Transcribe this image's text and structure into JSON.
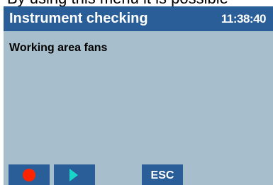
{
  "caption": {
    "text": "By using this menu it is possible"
  },
  "window": {
    "title": "Instrument checking",
    "clock": "11:38:40"
  },
  "content": {
    "heading": "Working area fans"
  },
  "softkeys": {
    "record": {
      "icon": "record-icon",
      "color": "#ff2400"
    },
    "play": {
      "icon": "play-icon",
      "color": "#18d4c9"
    },
    "esc": {
      "label": "ESC"
    }
  },
  "colors": {
    "title_bar": "#2a5e98",
    "screen_background": "#a7bfcc",
    "key_background": "#2a5e98"
  }
}
